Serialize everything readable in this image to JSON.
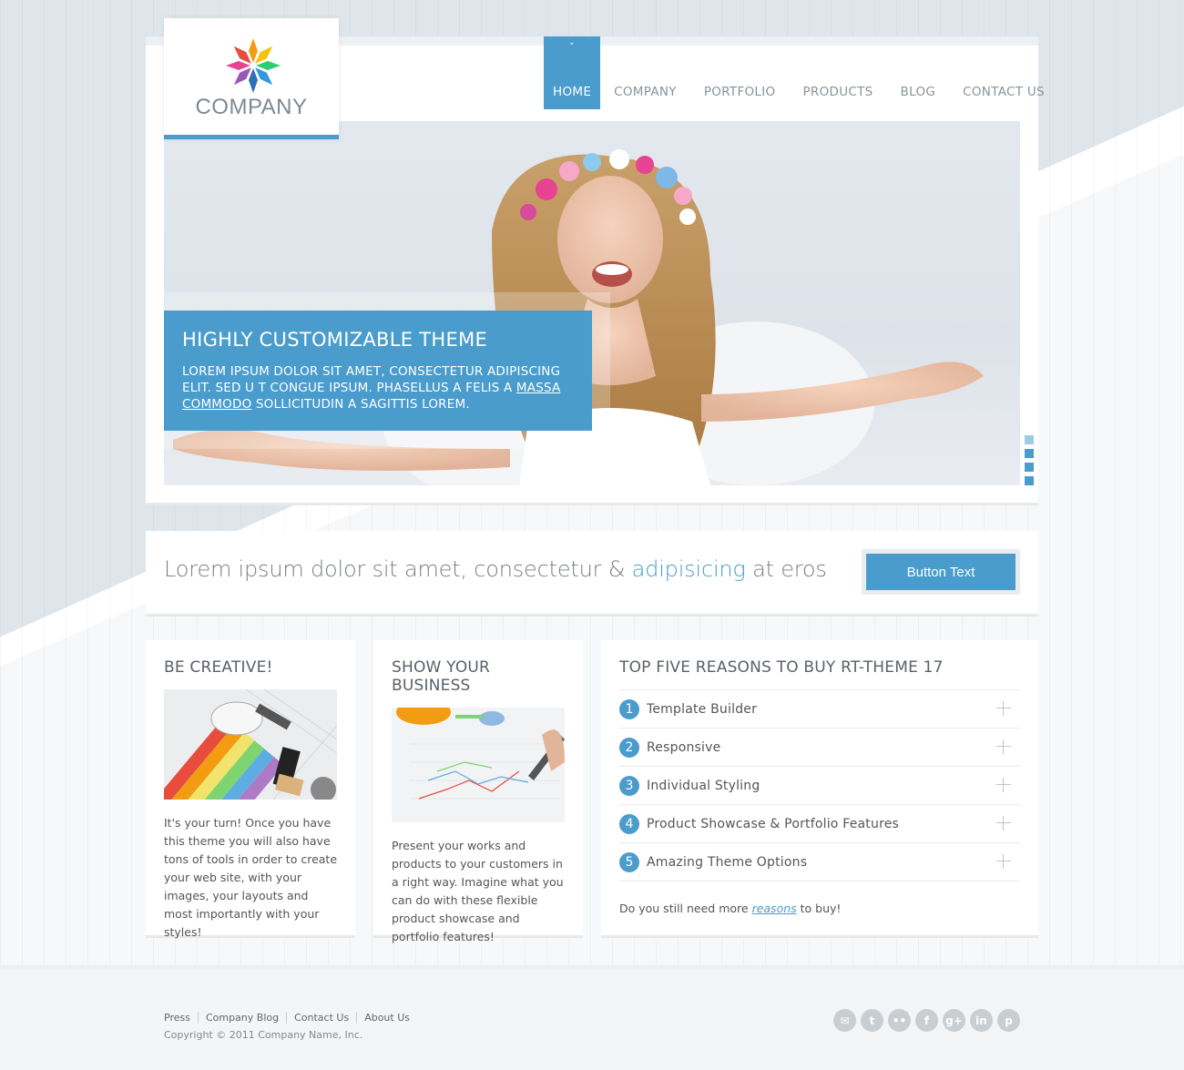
{
  "brand": {
    "name": "COMPANY"
  },
  "nav": {
    "items": [
      {
        "label": "HOME",
        "active": true
      },
      {
        "label": "COMPANY"
      },
      {
        "label": "PORTFOLIO"
      },
      {
        "label": "PRODUCTS"
      },
      {
        "label": "BLOG"
      },
      {
        "label": "CONTACT US"
      }
    ]
  },
  "slider": {
    "caption_title": "HIGHLY CUSTOMIZABLE THEME",
    "caption_text_1": "LOREM IPSUM DOLOR SIT AMET, CONSECTETUR ADIPISCING ELIT. SED U T CONGUE IPSUM. PHASELLUS A FELIS A ",
    "caption_link": "MASSA COMMODO",
    "caption_text_2": " SOLLICITUDIN A SAGITTIS LOREM.",
    "slide_count": 4,
    "active_slide": 1
  },
  "tagline": {
    "before": "Lorem ipsum dolor sit amet, consectetur & ",
    "highlight": "adipisicing",
    "after": " at eros",
    "button_label": "Button Text"
  },
  "columns": {
    "col1": {
      "title": "BE CREATIVE!",
      "text": "It's your turn! Once you have this theme you will also have tons of tools in order to create your web site, with your images, your layouts and most importantly with your styles!"
    },
    "col2": {
      "title": "SHOW YOUR BUSINESS",
      "text": "Present your works and products to your customers in a right way. Imagine what you can do with these flexible product showcase and portfolio features!"
    },
    "col3": {
      "title": "TOP FIVE REASONS TO BUY RT-THEME 17",
      "reasons": [
        {
          "num": "1",
          "label": "Template Builder"
        },
        {
          "num": "2",
          "label": "Responsive"
        },
        {
          "num": "3",
          "label": "Individual Styling"
        },
        {
          "num": "4",
          "label": "Product Showcase & Portfolio Features"
        },
        {
          "num": "5",
          "label": "Amazing Theme Options"
        }
      ],
      "note_before": "Do you still need more ",
      "note_link": "reasons",
      "note_after": " to buy!"
    }
  },
  "footer": {
    "links": [
      "Press",
      "Company Blog",
      "Contact Us",
      "About Us"
    ],
    "copyright": "Copyright © 2011 Company Name, Inc.",
    "social": [
      {
        "icon": "email-icon",
        "glyph": "✉"
      },
      {
        "icon": "twitter-icon",
        "glyph": "t"
      },
      {
        "icon": "flickr-icon",
        "glyph": "••"
      },
      {
        "icon": "facebook-icon",
        "glyph": "f"
      },
      {
        "icon": "google-plus-icon",
        "glyph": "g+"
      },
      {
        "icon": "linkedin-icon",
        "glyph": "in"
      },
      {
        "icon": "pinterest-icon",
        "glyph": "p"
      }
    ]
  },
  "colors": {
    "accent": "#4a9ccc",
    "background": "#dfe6eb",
    "text": "#555555"
  }
}
